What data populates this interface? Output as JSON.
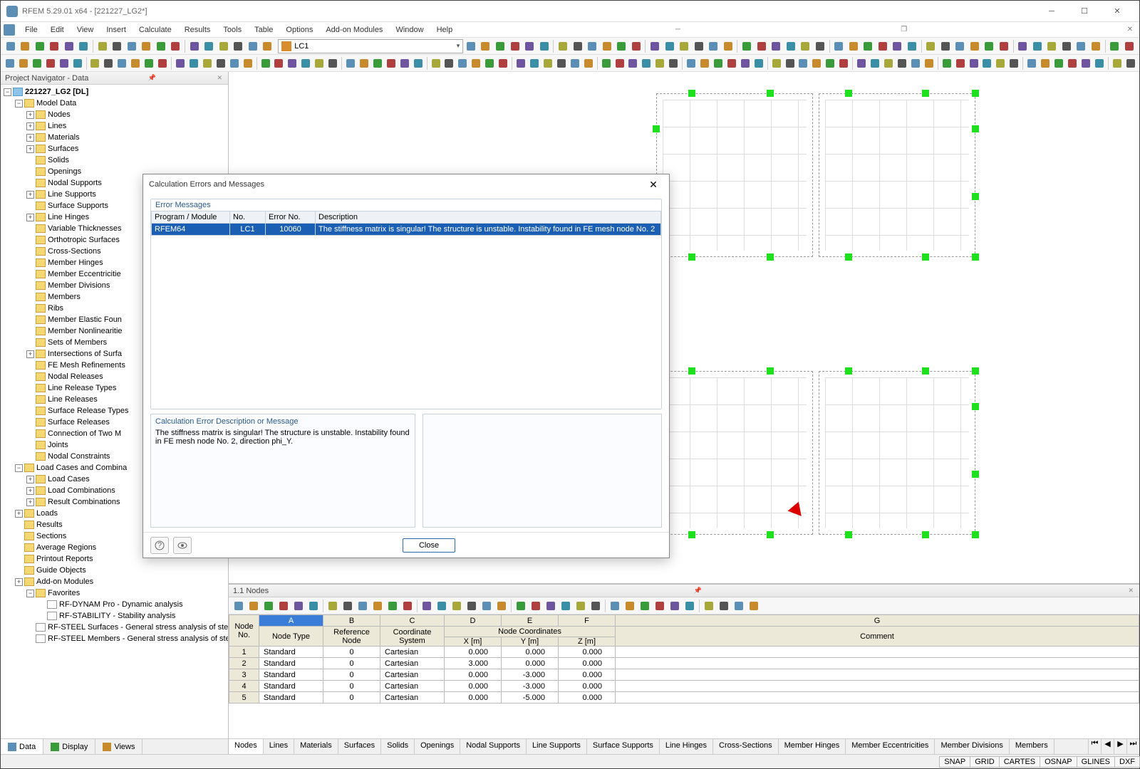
{
  "window": {
    "title": "RFEM 5.29.01 x64 - [221227_LG2*]"
  },
  "menu": [
    "File",
    "Edit",
    "View",
    "Insert",
    "Calculate",
    "Results",
    "Tools",
    "Table",
    "Options",
    "Add-on Modules",
    "Window",
    "Help"
  ],
  "lc_combo": "LC1",
  "navigator": {
    "title": "Project Navigator - Data",
    "root": "221227_LG2 [DL]",
    "model_data": "Model Data",
    "items": [
      "Nodes",
      "Lines",
      "Materials",
      "Surfaces",
      "Solids",
      "Openings",
      "Nodal Supports",
      "Line Supports",
      "Surface Supports",
      "Line Hinges",
      "Variable Thicknesses",
      "Orthotropic Surfaces",
      "Cross-Sections",
      "Member Hinges",
      "Member Eccentricitie",
      "Member Divisions",
      "Members",
      "Ribs",
      "Member Elastic Foun",
      "Member Nonlinearitie",
      "Sets of Members",
      "Intersections of Surfa",
      "FE Mesh Refinements",
      "Nodal Releases",
      "Line Release Types",
      "Line Releases",
      "Surface Release Types",
      "Surface Releases",
      "Connection of Two M",
      "Joints",
      "Nodal Constraints"
    ],
    "lc_group": "Load Cases and Combina",
    "lc_children": [
      "Load Cases",
      "Load Combinations",
      "Result Combinations"
    ],
    "others": [
      "Loads",
      "Results",
      "Sections",
      "Average Regions",
      "Printout Reports",
      "Guide Objects",
      "Add-on Modules"
    ],
    "favorites": "Favorites",
    "fav_children": [
      "RF-DYNAM Pro - Dynamic analysis",
      "RF-STABILITY - Stability analysis"
    ],
    "steel": [
      "RF-STEEL Surfaces - General stress analysis of steel surf",
      "RF-STEEL Members - General stress analysis of steel me"
    ],
    "tabs": [
      "Data",
      "Display",
      "Views"
    ]
  },
  "dialog": {
    "title": "Calculation Errors and Messages",
    "grp_err": "Error Messages",
    "cols": [
      "Program / Module",
      "No.",
      "Error No.",
      "Description"
    ],
    "row": {
      "prog": "RFEM64",
      "no": "LC1",
      "err": "10060",
      "desc": "The stiffness matrix is singular! The structure is unstable. Instability found in FE mesh node No. 2"
    },
    "desc_label": "Calculation Error Description or Message",
    "desc_text": "The stiffness matrix is singular! The structure is unstable. Instability found in FE mesh node No. 2, direction phi_Y.",
    "close": "Close"
  },
  "bottom": {
    "title": "1.1 Nodes",
    "col_letters": [
      "A",
      "B",
      "C",
      "D",
      "E",
      "F",
      "G"
    ],
    "head1": {
      "node": "Node",
      "ref": "Reference",
      "coord": "Coordinate",
      "group": "Node Coordinates"
    },
    "head2": {
      "no": "No.",
      "ntype": "Node Type",
      "refnode": "Node",
      "sys": "System",
      "x": "X [m]",
      "y": "Y [m]",
      "z": "Z [m]",
      "cmt": "Comment"
    },
    "rows": [
      {
        "n": "1",
        "t": "Standard",
        "r": "0",
        "s": "Cartesian",
        "x": "0.000",
        "y": "0.000",
        "z": "0.000"
      },
      {
        "n": "2",
        "t": "Standard",
        "r": "0",
        "s": "Cartesian",
        "x": "3.000",
        "y": "0.000",
        "z": "0.000"
      },
      {
        "n": "3",
        "t": "Standard",
        "r": "0",
        "s": "Cartesian",
        "x": "0.000",
        "y": "-3.000",
        "z": "0.000"
      },
      {
        "n": "4",
        "t": "Standard",
        "r": "0",
        "s": "Cartesian",
        "x": "0.000",
        "y": "-3.000",
        "z": "0.000"
      },
      {
        "n": "5",
        "t": "Standard",
        "r": "0",
        "s": "Cartesian",
        "x": "0.000",
        "y": "-5.000",
        "z": "0.000"
      }
    ],
    "tabs": [
      "Nodes",
      "Lines",
      "Materials",
      "Surfaces",
      "Solids",
      "Openings",
      "Nodal Supports",
      "Line Supports",
      "Surface Supports",
      "Line Hinges",
      "Cross-Sections",
      "Member Hinges",
      "Member Eccentricities",
      "Member Divisions",
      "Members"
    ]
  },
  "status": [
    "SNAP",
    "GRID",
    "CARTES",
    "OSNAP",
    "GLINES",
    "DXF"
  ]
}
